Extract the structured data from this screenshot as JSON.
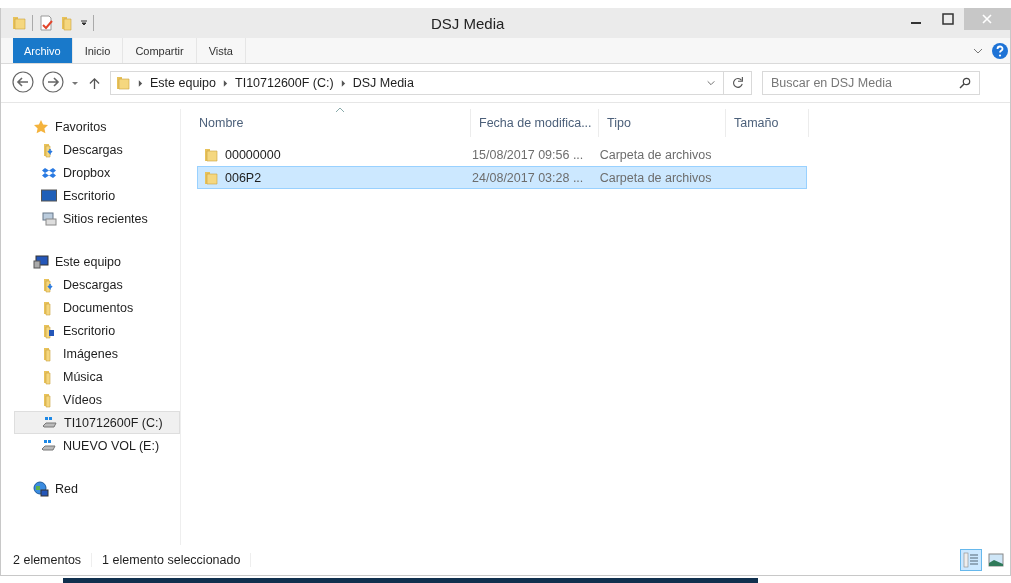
{
  "window": {
    "title": "DSJ Media"
  },
  "ribbon_tabs": [
    {
      "label": "Archivo",
      "kind": "file"
    },
    {
      "label": "Inicio",
      "kind": "tab"
    },
    {
      "label": "Compartir",
      "kind": "tab"
    },
    {
      "label": "Vista",
      "kind": "tab"
    }
  ],
  "breadcrumb": [
    "Este equipo",
    "TI10712600F (C:)",
    "DSJ Media"
  ],
  "search": {
    "placeholder": "Buscar en DSJ Media"
  },
  "sidebar": [
    {
      "label": "Favoritos",
      "kind": "star",
      "selected": false,
      "children": [
        {
          "label": "Descargas",
          "kind": "downloads",
          "selected": false
        },
        {
          "label": "Dropbox",
          "kind": "dropbox",
          "selected": false
        },
        {
          "label": "Escritorio",
          "kind": "desktop",
          "selected": false
        },
        {
          "label": "Sitios recientes",
          "kind": "recent",
          "selected": false
        }
      ]
    },
    {
      "label": "Este equipo",
      "kind": "pc",
      "selected": false,
      "children": [
        {
          "label": "Descargas",
          "kind": "downloads",
          "selected": false
        },
        {
          "label": "Documentos",
          "kind": "folder",
          "selected": false
        },
        {
          "label": "Escritorio",
          "kind": "desktop-folder",
          "selected": false
        },
        {
          "label": "Imágenes",
          "kind": "folder",
          "selected": false
        },
        {
          "label": "Música",
          "kind": "folder",
          "selected": false
        },
        {
          "label": "Vídeos",
          "kind": "folder",
          "selected": false
        },
        {
          "label": "TI10712600F (C:)",
          "kind": "drive",
          "selected": true
        },
        {
          "label": "NUEVO VOL (E:)",
          "kind": "drive",
          "selected": false
        }
      ]
    },
    {
      "label": "Red",
      "kind": "network",
      "selected": false
    }
  ],
  "table": {
    "columns": [
      "Nombre",
      "Fecha de modifica...",
      "Tipo",
      "Tamaño"
    ],
    "rows": [
      {
        "name": "00000000",
        "date": "15/08/2017 09:56 ...",
        "type": "Carpeta de archivos",
        "selected": false
      },
      {
        "name": "006P2",
        "date": "24/08/2017 03:28 ...",
        "type": "Carpeta de archivos",
        "selected": true
      }
    ]
  },
  "status_bar": {
    "count": "2 elementos",
    "selection": "1 elemento seleccionado"
  },
  "view_buttons": [
    {
      "kind": "details",
      "selected": true
    },
    {
      "kind": "thumbnails",
      "selected": false
    }
  ]
}
